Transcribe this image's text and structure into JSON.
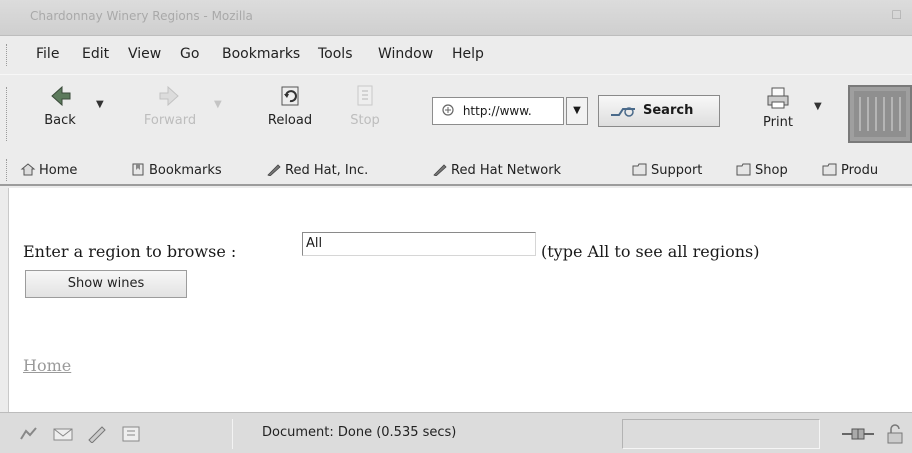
{
  "window": {
    "title": "Chardonnay Winery Regions - Mozilla"
  },
  "menu": {
    "items": [
      {
        "label": "File"
      },
      {
        "label": "Edit"
      },
      {
        "label": "View"
      },
      {
        "label": "Go"
      },
      {
        "label": "Bookmarks"
      },
      {
        "label": "Tools"
      },
      {
        "label": "Window"
      },
      {
        "label": "Help"
      }
    ]
  },
  "toolbar": {
    "back_label": "Back",
    "forward_label": "Forward",
    "reload_label": "Reload",
    "stop_label": "Stop",
    "url_value": "http://www.",
    "search_label": "Search",
    "print_label": "Print"
  },
  "personal_bar": {
    "items": [
      {
        "label": "Home",
        "icon": "home-icon"
      },
      {
        "label": "Bookmarks",
        "icon": "bookmarks-icon"
      },
      {
        "label": "Red Hat, Inc.",
        "icon": "link-icon"
      },
      {
        "label": "Red Hat Network",
        "icon": "link-icon"
      },
      {
        "label": "Support",
        "icon": "folder-icon"
      },
      {
        "label": "Shop",
        "icon": "folder-icon"
      },
      {
        "label": "Produ",
        "icon": "folder-icon"
      }
    ]
  },
  "page": {
    "prompt": "Enter a region to browse :",
    "region_value": "All",
    "hint": "(type All to see all regions)",
    "submit_label": "Show wines",
    "home_link": "Home"
  },
  "status": {
    "text": "Document: Done (0.535 secs)"
  },
  "colors": {
    "chrome_bg": "#ececec",
    "content_bg": "#ffffff",
    "link_visited": "#9a9a9a"
  }
}
